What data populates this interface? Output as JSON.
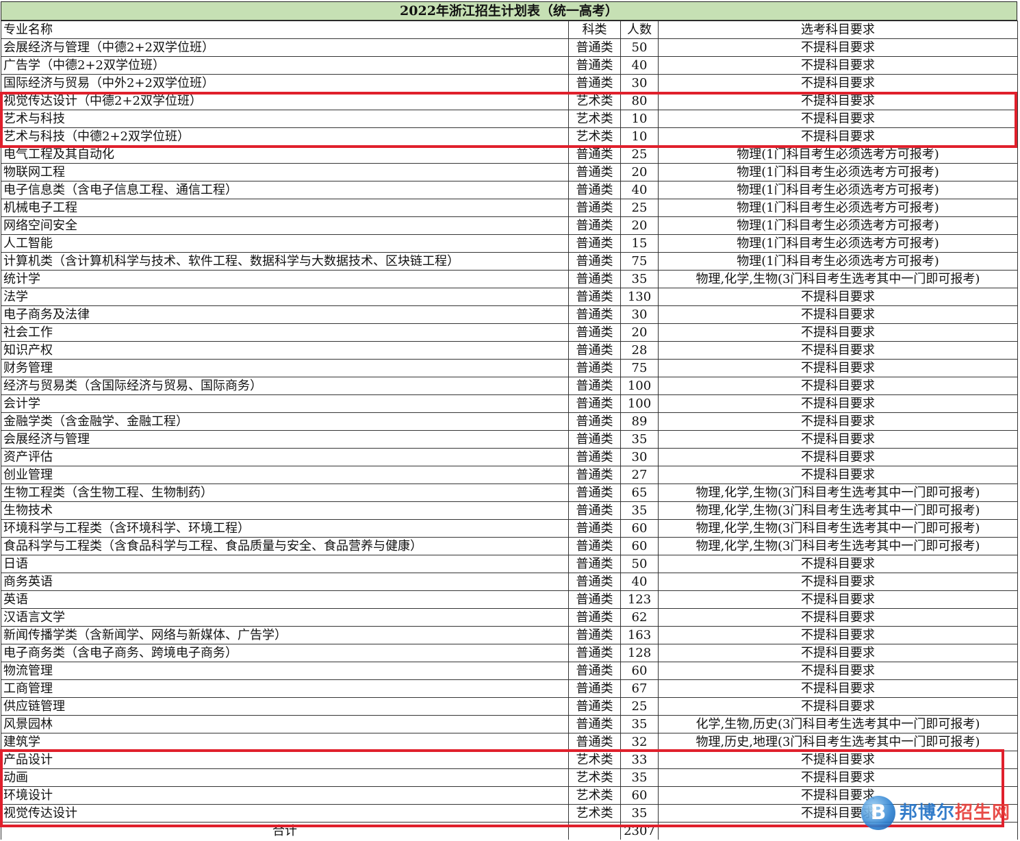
{
  "title": "2022年浙江招生计划表（统一高考）",
  "headers": [
    "专业名称",
    "科类",
    "人数",
    "选考科目要求"
  ],
  "rows": [
    [
      "会展经济与管理（中德2+2双学位班）",
      "普通类",
      "50",
      "不提科目要求"
    ],
    [
      "广告学（中德2+2双学位班）",
      "普通类",
      "40",
      "不提科目要求"
    ],
    [
      "国际经济与贸易（中外2+2双学位班）",
      "普通类",
      "30",
      "不提科目要求"
    ],
    [
      "视觉传达设计（中德2+2双学位班）",
      "艺术类",
      "80",
      "不提科目要求"
    ],
    [
      "艺术与科技",
      "艺术类",
      "10",
      "不提科目要求"
    ],
    [
      "艺术与科技（中德2+2双学位班）",
      "艺术类",
      "10",
      "不提科目要求"
    ],
    [
      "电气工程及其自动化",
      "普通类",
      "25",
      "物理(1门科目考生必须选考方可报考)"
    ],
    [
      "物联网工程",
      "普通类",
      "20",
      "物理(1门科目考生必须选考方可报考)"
    ],
    [
      "电子信息类（含电子信息工程、通信工程）",
      "普通类",
      "40",
      "物理(1门科目考生必须选考方可报考)"
    ],
    [
      "机械电子工程",
      "普通类",
      "25",
      "物理(1门科目考生必须选考方可报考)"
    ],
    [
      "网络空间安全",
      "普通类",
      "20",
      "物理(1门科目考生必须选考方可报考)"
    ],
    [
      "人工智能",
      "普通类",
      "15",
      "物理(1门科目考生必须选考方可报考)"
    ],
    [
      "计算机类（含计算机科学与技术、软件工程、数据科学与大数据技术、区块链工程）",
      "普通类",
      "75",
      "物理(1门科目考生必须选考方可报考)"
    ],
    [
      "统计学",
      "普通类",
      "35",
      "物理,化学,生物(3门科目考生选考其中一门即可报考)"
    ],
    [
      "法学",
      "普通类",
      "130",
      "不提科目要求"
    ],
    [
      "电子商务及法律",
      "普通类",
      "30",
      "不提科目要求"
    ],
    [
      "社会工作",
      "普通类",
      "20",
      "不提科目要求"
    ],
    [
      "知识产权",
      "普通类",
      "28",
      "不提科目要求"
    ],
    [
      "财务管理",
      "普通类",
      "75",
      "不提科目要求"
    ],
    [
      "经济与贸易类（含国际经济与贸易、国际商务）",
      "普通类",
      "100",
      "不提科目要求"
    ],
    [
      "会计学",
      "普通类",
      "100",
      "不提科目要求"
    ],
    [
      "金融学类（含金融学、金融工程）",
      "普通类",
      "89",
      "不提科目要求"
    ],
    [
      "会展经济与管理",
      "普通类",
      "35",
      "不提科目要求"
    ],
    [
      "资产评估",
      "普通类",
      "30",
      "不提科目要求"
    ],
    [
      "创业管理",
      "普通类",
      "27",
      "不提科目要求"
    ],
    [
      "生物工程类（含生物工程、生物制药）",
      "普通类",
      "65",
      "物理,化学,生物(3门科目考生选考其中一门即可报考)"
    ],
    [
      "生物技术",
      "普通类",
      "35",
      "物理,化学,生物(3门科目考生选考其中一门即可报考)"
    ],
    [
      "环境科学与工程类（含环境科学、环境工程）",
      "普通类",
      "60",
      "物理,化学,生物(3门科目考生选考其中一门即可报考)"
    ],
    [
      "食品科学与工程类（含食品科学与工程、食品质量与安全、食品营养与健康）",
      "普通类",
      "60",
      "物理,化学,生物(3门科目考生选考其中一门即可报考)"
    ],
    [
      "日语",
      "普通类",
      "50",
      "不提科目要求"
    ],
    [
      "商务英语",
      "普通类",
      "40",
      "不提科目要求"
    ],
    [
      "英语",
      "普通类",
      "123",
      "不提科目要求"
    ],
    [
      "汉语言文学",
      "普通类",
      "62",
      "不提科目要求"
    ],
    [
      "新闻传播学类（含新闻学、网络与新媒体、广告学）",
      "普通类",
      "163",
      "不提科目要求"
    ],
    [
      "电子商务类（含电子商务、跨境电子商务）",
      "普通类",
      "128",
      "不提科目要求"
    ],
    [
      "物流管理",
      "普通类",
      "60",
      "不提科目要求"
    ],
    [
      "工商管理",
      "普通类",
      "67",
      "不提科目要求"
    ],
    [
      "供应链管理",
      "普通类",
      "25",
      "不提科目要求"
    ],
    [
      "风景园林",
      "普通类",
      "35",
      "化学,生物,历史(3门科目考生选考其中一门即可报考)"
    ],
    [
      "建筑学",
      "普通类",
      "32",
      "物理,历史,地理(3门科目考生选考其中一门即可报考)"
    ],
    [
      "产品设计",
      "艺术类",
      "33",
      "不提科目要求"
    ],
    [
      "动画",
      "艺术类",
      "35",
      "不提科目要求"
    ],
    [
      "环境设计",
      "艺术类",
      "60",
      "不提科目要求"
    ],
    [
      "视觉传达设计",
      "艺术类",
      "35",
      "不提科目要求"
    ]
  ],
  "total": {
    "label": "合计",
    "value": "2307"
  },
  "watermark": {
    "logo_letter": "B",
    "name_part1": "邦博尔",
    "name_part2": "招生网"
  },
  "colors": {
    "title_bg": "#c6e0b4",
    "highlight": "#e0202c"
  }
}
